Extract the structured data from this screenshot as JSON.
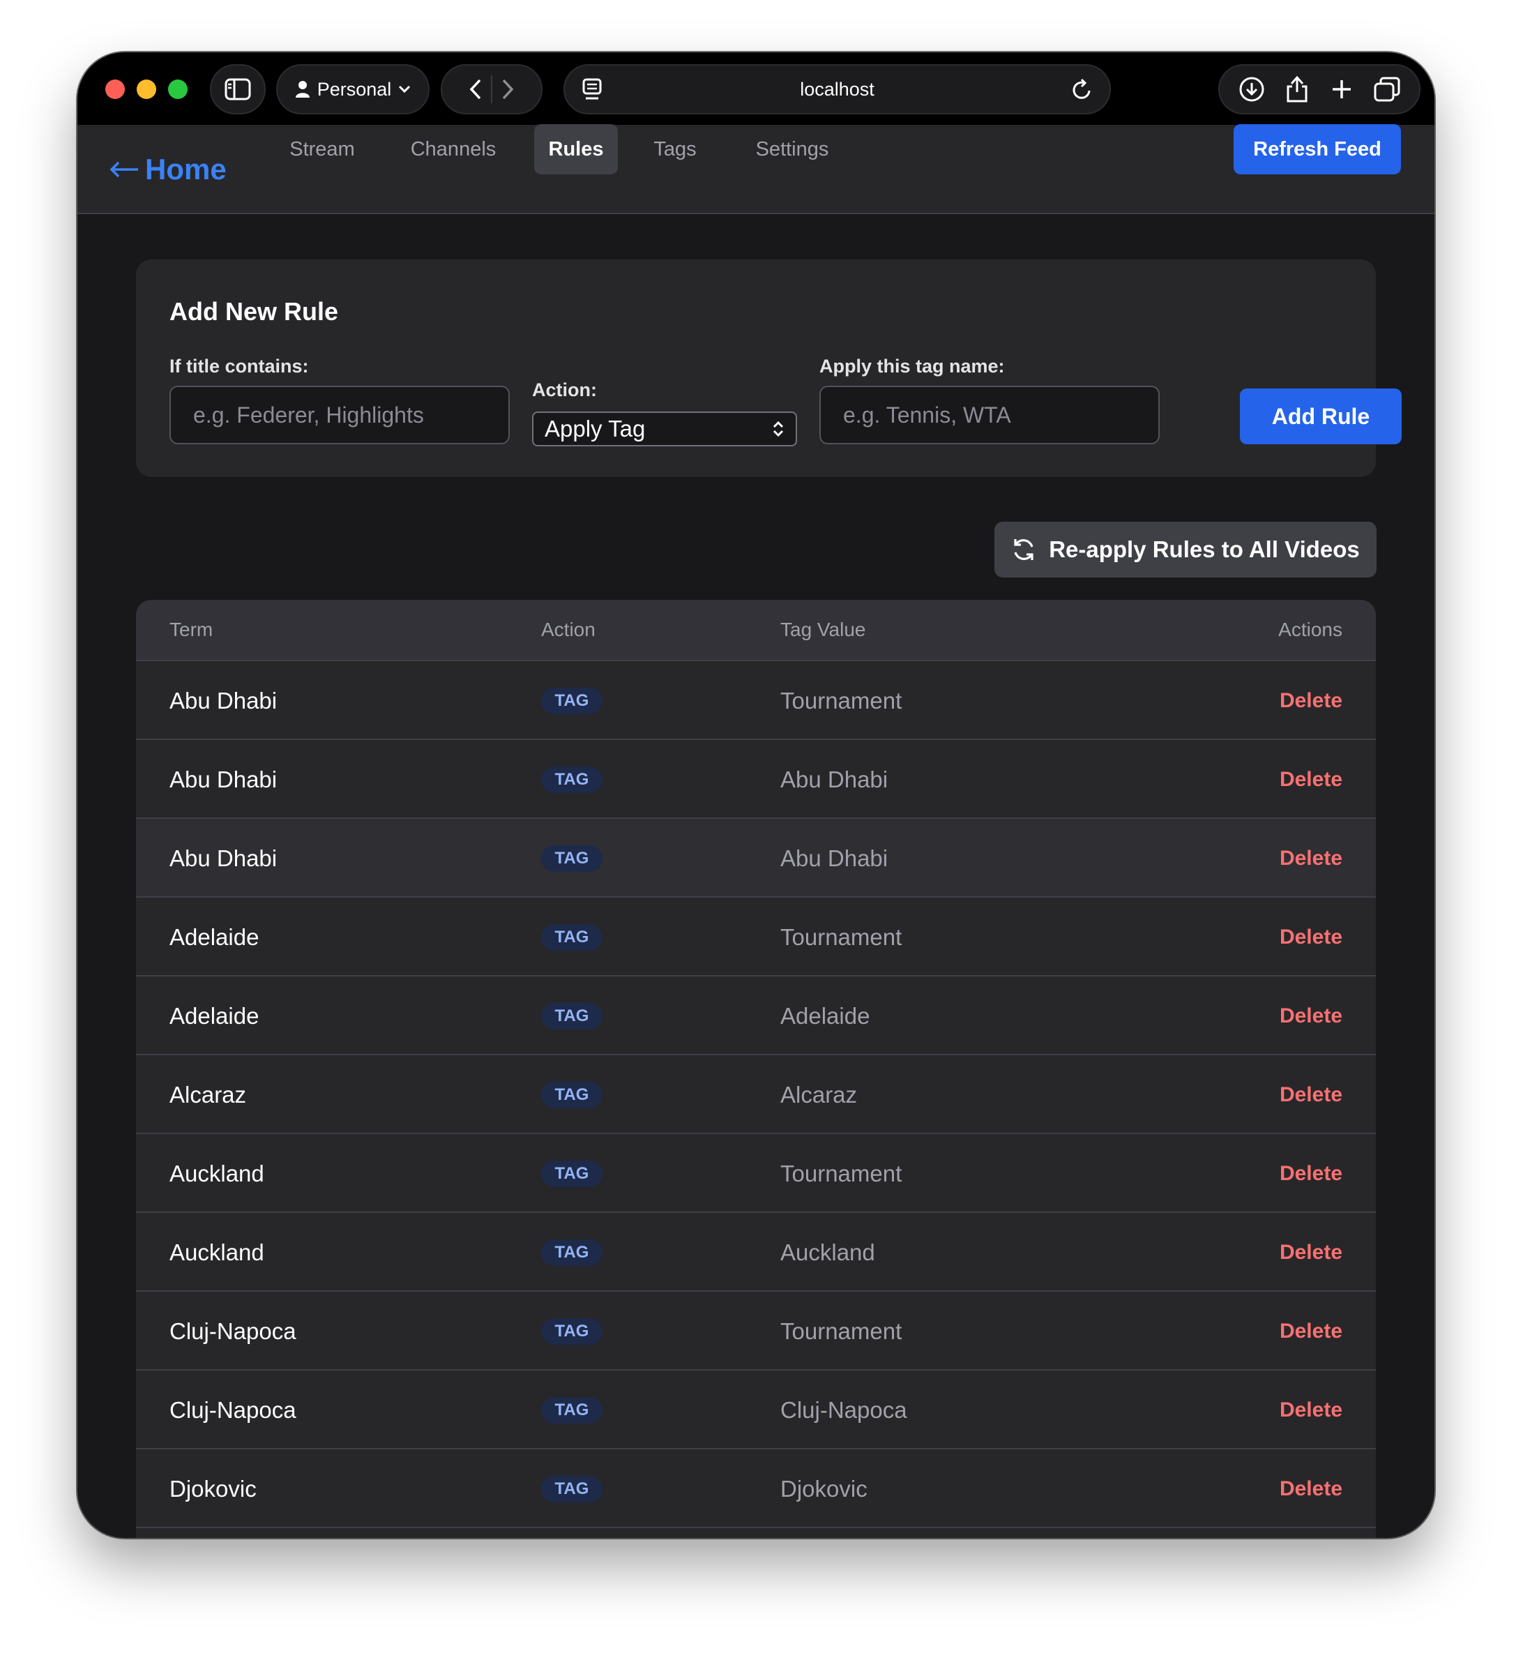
{
  "browser": {
    "profile_label": "Personal",
    "url": "localhost"
  },
  "nav": {
    "home_label": "Home",
    "items": [
      {
        "label": "Stream",
        "active": false
      },
      {
        "label": "Channels",
        "active": false
      },
      {
        "label": "Rules",
        "active": true
      },
      {
        "label": "Tags",
        "active": false
      },
      {
        "label": "Settings",
        "active": false
      }
    ],
    "refresh_label": "Refresh Feed"
  },
  "add_rule": {
    "title": "Add New Rule",
    "term_label": "If title contains:",
    "term_placeholder": "e.g. Federer, Highlights",
    "action_label": "Action:",
    "action_selected": "Apply Tag",
    "tag_label": "Apply this tag name:",
    "tag_placeholder": "e.g. Tennis, WTA",
    "submit_label": "Add Rule"
  },
  "reapply_label": "Re-apply Rules to All Videos",
  "table": {
    "headers": {
      "term": "Term",
      "action": "Action",
      "tag_value": "Tag Value",
      "actions": "Actions"
    },
    "delete_label": "Delete",
    "rows": [
      {
        "term": "Abu Dhabi",
        "action": "TAG",
        "value": "Tournament"
      },
      {
        "term": "Abu Dhabi",
        "action": "TAG",
        "value": "Abu Dhabi"
      },
      {
        "term": "Abu Dhabi",
        "action": "TAG",
        "value": "Abu Dhabi"
      },
      {
        "term": "Adelaide",
        "action": "TAG",
        "value": "Tournament"
      },
      {
        "term": "Adelaide",
        "action": "TAG",
        "value": "Adelaide"
      },
      {
        "term": "Alcaraz",
        "action": "TAG",
        "value": "Alcaraz"
      },
      {
        "term": "Auckland",
        "action": "TAG",
        "value": "Tournament"
      },
      {
        "term": "Auckland",
        "action": "TAG",
        "value": "Auckland"
      },
      {
        "term": "Cluj-Napoca",
        "action": "TAG",
        "value": "Tournament"
      },
      {
        "term": "Cluj-Napoca",
        "action": "TAG",
        "value": "Cluj-Napoca"
      },
      {
        "term": "Djokovic",
        "action": "TAG",
        "value": "Djokovic"
      }
    ]
  },
  "colors": {
    "accent": "#2563eb",
    "link": "#3b82f6",
    "danger": "#f87171",
    "background": "#18181b",
    "surface": "#27272a"
  }
}
